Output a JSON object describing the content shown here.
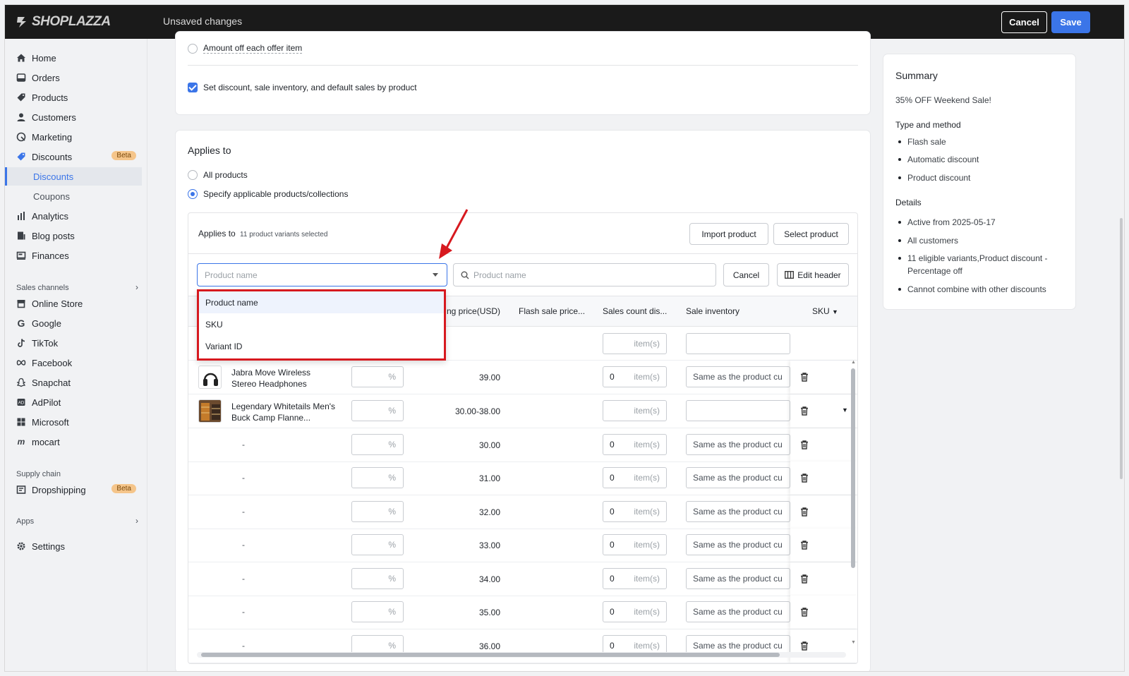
{
  "topbar": {
    "brand": "SHOPLAZZA",
    "status": "Unsaved changes",
    "cancel_label": "Cancel",
    "save_label": "Save"
  },
  "sidebar": {
    "items": [
      {
        "label": "Home",
        "icon": "home-icon"
      },
      {
        "label": "Orders",
        "icon": "orders-icon"
      },
      {
        "label": "Products",
        "icon": "tag-icon"
      },
      {
        "label": "Customers",
        "icon": "user-icon"
      },
      {
        "label": "Marketing",
        "icon": "marketing-icon"
      },
      {
        "label": "Discounts",
        "icon": "discount-icon",
        "badge": "Beta"
      },
      {
        "label": "Discounts",
        "sub": true,
        "active": true
      },
      {
        "label": "Coupons",
        "sub": true
      },
      {
        "label": "Analytics",
        "icon": "analytics-icon"
      },
      {
        "label": "Blog posts",
        "icon": "blog-icon"
      },
      {
        "label": "Finances",
        "icon": "finances-icon"
      }
    ],
    "sales_channels_label": "Sales channels",
    "channels": [
      {
        "label": "Online Store",
        "icon": "store-icon"
      },
      {
        "label": "Google",
        "icon": "google-icon"
      },
      {
        "label": "TikTok",
        "icon": "tiktok-icon"
      },
      {
        "label": "Facebook",
        "icon": "facebook-icon"
      },
      {
        "label": "Snapchat",
        "icon": "snapchat-icon"
      },
      {
        "label": "AdPilot",
        "icon": "adpilot-icon"
      },
      {
        "label": "Microsoft",
        "icon": "microsoft-icon"
      },
      {
        "label": "mocart",
        "icon": "mocart-icon"
      }
    ],
    "supply_chain_label": "Supply chain",
    "dropshipping": {
      "label": "Dropshipping",
      "badge": "Beta"
    },
    "apps_label": "Apps",
    "settings_label": "Settings"
  },
  "offer": {
    "amount_off_label": "Amount off each offer item",
    "set_by_product_label": "Set discount, sale inventory, and default sales by product"
  },
  "applies": {
    "title": "Applies to",
    "all_products": "All products",
    "specify": "Specify applicable products/collections",
    "header_label": "Applies to",
    "selected_count": "11 product variants selected",
    "import_label": "Import product",
    "select_label": "Select product",
    "filter_placeholder": "Product name",
    "search_placeholder": "Product name",
    "cancel_label": "Cancel",
    "edit_header_label": "Edit header",
    "dropdown_options": [
      "Product name",
      "SKU",
      "Variant ID"
    ],
    "columns": {
      "price": "ng price(USD)",
      "flash": "Flash sale price...",
      "sales_count": "Sales count dis...",
      "inventory": "Sale inventory",
      "sku": "SKU"
    },
    "pct_unit": "%",
    "item_unit": "item(s)",
    "inventory_default": "Same as the product cu",
    "rows": [
      {
        "name": "Jabra Move Wireless Stereo Headphones",
        "price": "39.00",
        "count": "0",
        "inventory": "Same as the product cu",
        "thumb": "headphones"
      },
      {
        "name": "Legendary Whitetails Men's Buck Camp Flanne...",
        "price": "30.00-38.00",
        "count": "",
        "inventory": "",
        "thumb": "flannel",
        "expand": true
      },
      {
        "name": "-",
        "price": "30.00",
        "count": "0",
        "inventory": "Same as the product cu"
      },
      {
        "name": "-",
        "price": "31.00",
        "count": "0",
        "inventory": "Same as the product cu"
      },
      {
        "name": "-",
        "price": "32.00",
        "count": "0",
        "inventory": "Same as the product cu"
      },
      {
        "name": "-",
        "price": "33.00",
        "count": "0",
        "inventory": "Same as the product cu"
      },
      {
        "name": "-",
        "price": "34.00",
        "count": "0",
        "inventory": "Same as the product cu"
      },
      {
        "name": "-",
        "price": "35.00",
        "count": "0",
        "inventory": "Same as the product cu"
      },
      {
        "name": "-",
        "price": "36.00",
        "count": "0",
        "inventory": "Same as the product cu"
      }
    ]
  },
  "summary": {
    "title": "Summary",
    "name": "35% OFF Weekend Sale!",
    "type_heading": "Type and method",
    "type_items": [
      "Flash sale",
      "Automatic discount",
      "Product discount"
    ],
    "details_heading": "Details",
    "details_items": [
      "Active from 2025-05-17",
      "All customers",
      "11 eligible variants,Product discount - Percentage off",
      "Cannot combine with other discounts"
    ]
  },
  "colors": {
    "accent": "#3b75e8",
    "highlight": "#d7191f",
    "topbar": "#1a1a1a"
  }
}
